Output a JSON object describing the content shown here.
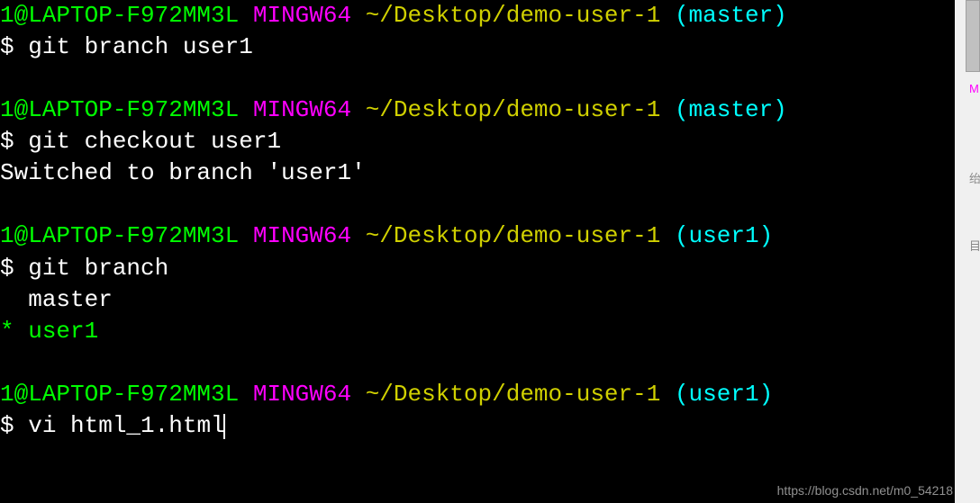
{
  "prompt": {
    "userhost": "1@LAPTOP-F972MM3L",
    "shell": "MINGW64",
    "path": "~/Desktop/demo-user-1",
    "branch_master": "(master)",
    "branch_user1": "(user1)",
    "symbol": "$"
  },
  "block1": {
    "command": "git branch user1"
  },
  "block2": {
    "command": "git checkout user1",
    "output": "Switched to branch 'user1'"
  },
  "block3": {
    "command": "git branch",
    "output_line1": "  master",
    "output_line2_marker": "*",
    "output_line2_branch": "user1"
  },
  "block4": {
    "command": "vi html_1.html"
  },
  "sidebar": {
    "char1": "绐",
    "char2": "M",
    "char3": "目"
  },
  "watermark": "https://blog.csdn.net/m0_54218"
}
